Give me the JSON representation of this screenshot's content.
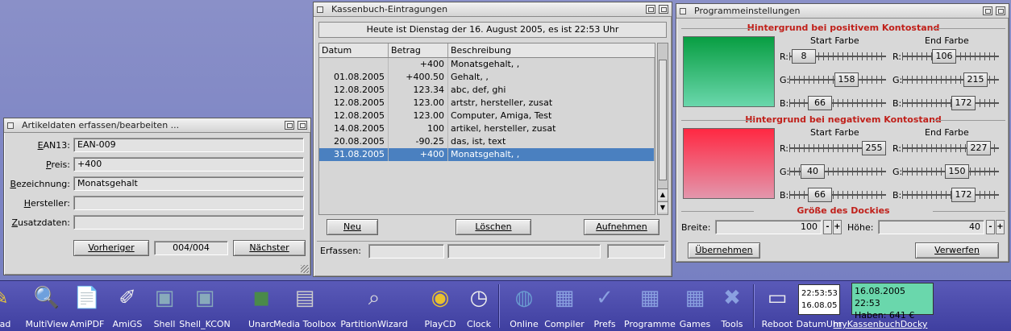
{
  "article_window": {
    "title": "Artikeldaten erfassen/bearbeiten ...",
    "fields": [
      {
        "label": "EAN13:",
        "value": "EAN-009"
      },
      {
        "label": "Preis:",
        "value": "+400"
      },
      {
        "label": "Bezeichnung:",
        "value": "Monatsgehalt"
      },
      {
        "label": "Hersteller:",
        "value": ""
      },
      {
        "label": "Zusatzdaten:",
        "value": ""
      }
    ],
    "prev_label": "Vorheriger",
    "counter": "004/004",
    "next_label": "Nächster"
  },
  "cashbook_window": {
    "title": "Kassenbuch-Eintragungen",
    "headline": "Heute ist Dienstag der 16. August 2005, es ist 22:53 Uhr",
    "columns": [
      "Datum",
      "Betrag",
      "Beschreibung"
    ],
    "rows": [
      {
        "date": "",
        "amount": "+400",
        "desc": "Monatsgehalt, ,"
      },
      {
        "date": "01.08.2005",
        "amount": "+400.50",
        "desc": "Gehalt, ,"
      },
      {
        "date": "12.08.2005",
        "amount": "123.34",
        "desc": "abc, def, ghi"
      },
      {
        "date": "12.08.2005",
        "amount": "123.00",
        "desc": "artstr, hersteller, zusat"
      },
      {
        "date": "12.08.2005",
        "amount": "123.00",
        "desc": "Computer, Amiga, Test"
      },
      {
        "date": "14.08.2005",
        "amount": "100",
        "desc": "artikel, hersteller, zusat"
      },
      {
        "date": "20.08.2005",
        "amount": "-90.25",
        "desc": "das, ist, text"
      },
      {
        "date": "31.08.2005",
        "amount": "+400",
        "desc": "Monatsgehalt, ,"
      }
    ],
    "selected_row": 7,
    "new_label": "Neu",
    "delete_label": "Löschen",
    "add_label": "Aufnehmen",
    "capture_label": "Erfassen:"
  },
  "settings_window": {
    "title": "Programmeinstellungen",
    "positive_heading": "Hintergrund bei positivem Kontostand",
    "negative_heading": "Hintergrund bei negativem Kontostand",
    "dock_heading": "Größe des Dockies",
    "start_label": "Start Farbe",
    "end_label": "End Farbe",
    "positive": {
      "start": {
        "R": 8,
        "G": 158,
        "B": 66
      },
      "end": {
        "R": 106,
        "G": 215,
        "B": 172
      }
    },
    "negative": {
      "start": {
        "R": 255,
        "G": 40,
        "B": 66
      },
      "end": {
        "R": 227,
        "G": 150,
        "B": 172
      }
    },
    "width_label": "Breite:",
    "width_value": "100",
    "height_label": "Höhe:",
    "height_value": "40",
    "apply_label": "Übernehmen",
    "discard_label": "Verwerfen"
  },
  "dock": {
    "group1": [
      "ePad",
      "MultiView",
      "AmiPDF",
      "AmiGS",
      "Shell",
      "Shell_KCON",
      "Unarc",
      "Media Toolbox",
      "PartitionWizard",
      "PlayCD",
      "Clock"
    ],
    "group2": [
      "Online",
      "Compiler",
      "Prefs",
      "Programme",
      "Games",
      "Tools"
    ],
    "group3": [
      "Reboot",
      "DatumUhr",
      "myKassenbuchDocky"
    ],
    "clock_time": "22:53:53",
    "clock_date": "16.08.05",
    "docky_datetime": "16.08.2005 22:53",
    "docky_balance": "Haben: 641 €"
  }
}
